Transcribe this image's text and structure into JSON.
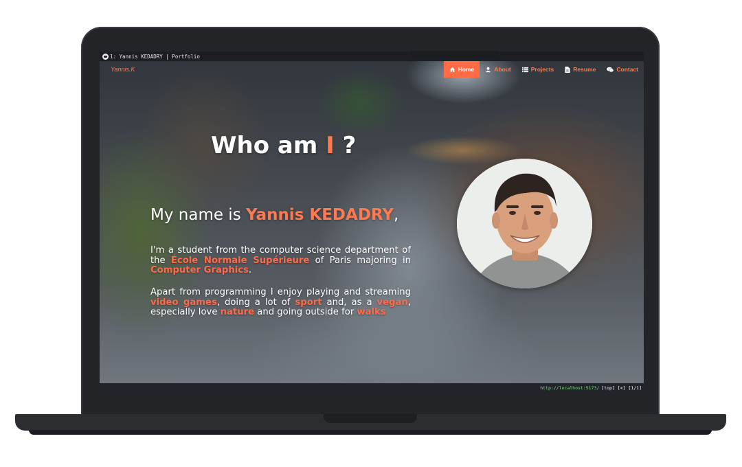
{
  "browser": {
    "tab_title": "1: Yannis KEDADRY | Portfolio",
    "status_url": "http://localhost:5173/",
    "status_position": "[top] [<] [1/1]"
  },
  "navbar": {
    "brand": "Yannis.K",
    "items": [
      {
        "label": "Home",
        "icon": "home-icon",
        "active": true
      },
      {
        "label": "About",
        "icon": "user-icon",
        "active": false
      },
      {
        "label": "Projects",
        "icon": "list-icon",
        "active": false
      },
      {
        "label": "Resume",
        "icon": "document-icon",
        "active": false
      },
      {
        "label": "Contact",
        "icon": "chat-icon",
        "active": false
      }
    ]
  },
  "hero": {
    "title_prefix": "Who am ",
    "title_accent": "I",
    "title_suffix": " ?",
    "intro_prefix": "My name is ",
    "intro_name": "Yannis KEDADRY",
    "intro_suffix": ",",
    "p1": {
      "t1": "I'm a student from the computer science department of the ",
      "h1": "École Normale Supérieure",
      "t2": " of Paris majoring in ",
      "h2": "Computer Graphics",
      "t3": "."
    },
    "p2": {
      "t1": "Apart from programming I enjoy playing and streaming ",
      "h1": "video games",
      "t2": ", doing a lot of ",
      "h2": "sport",
      "t3": " and, as a ",
      "h3": "vegan",
      "t4": ", especially love ",
      "h4": "nature",
      "t5": " and going outside for ",
      "h5": "walks"
    }
  },
  "colors": {
    "accent": "#ff7a50",
    "active_nav_bg": "#ff6b45",
    "laptop_frame": "#232428"
  }
}
